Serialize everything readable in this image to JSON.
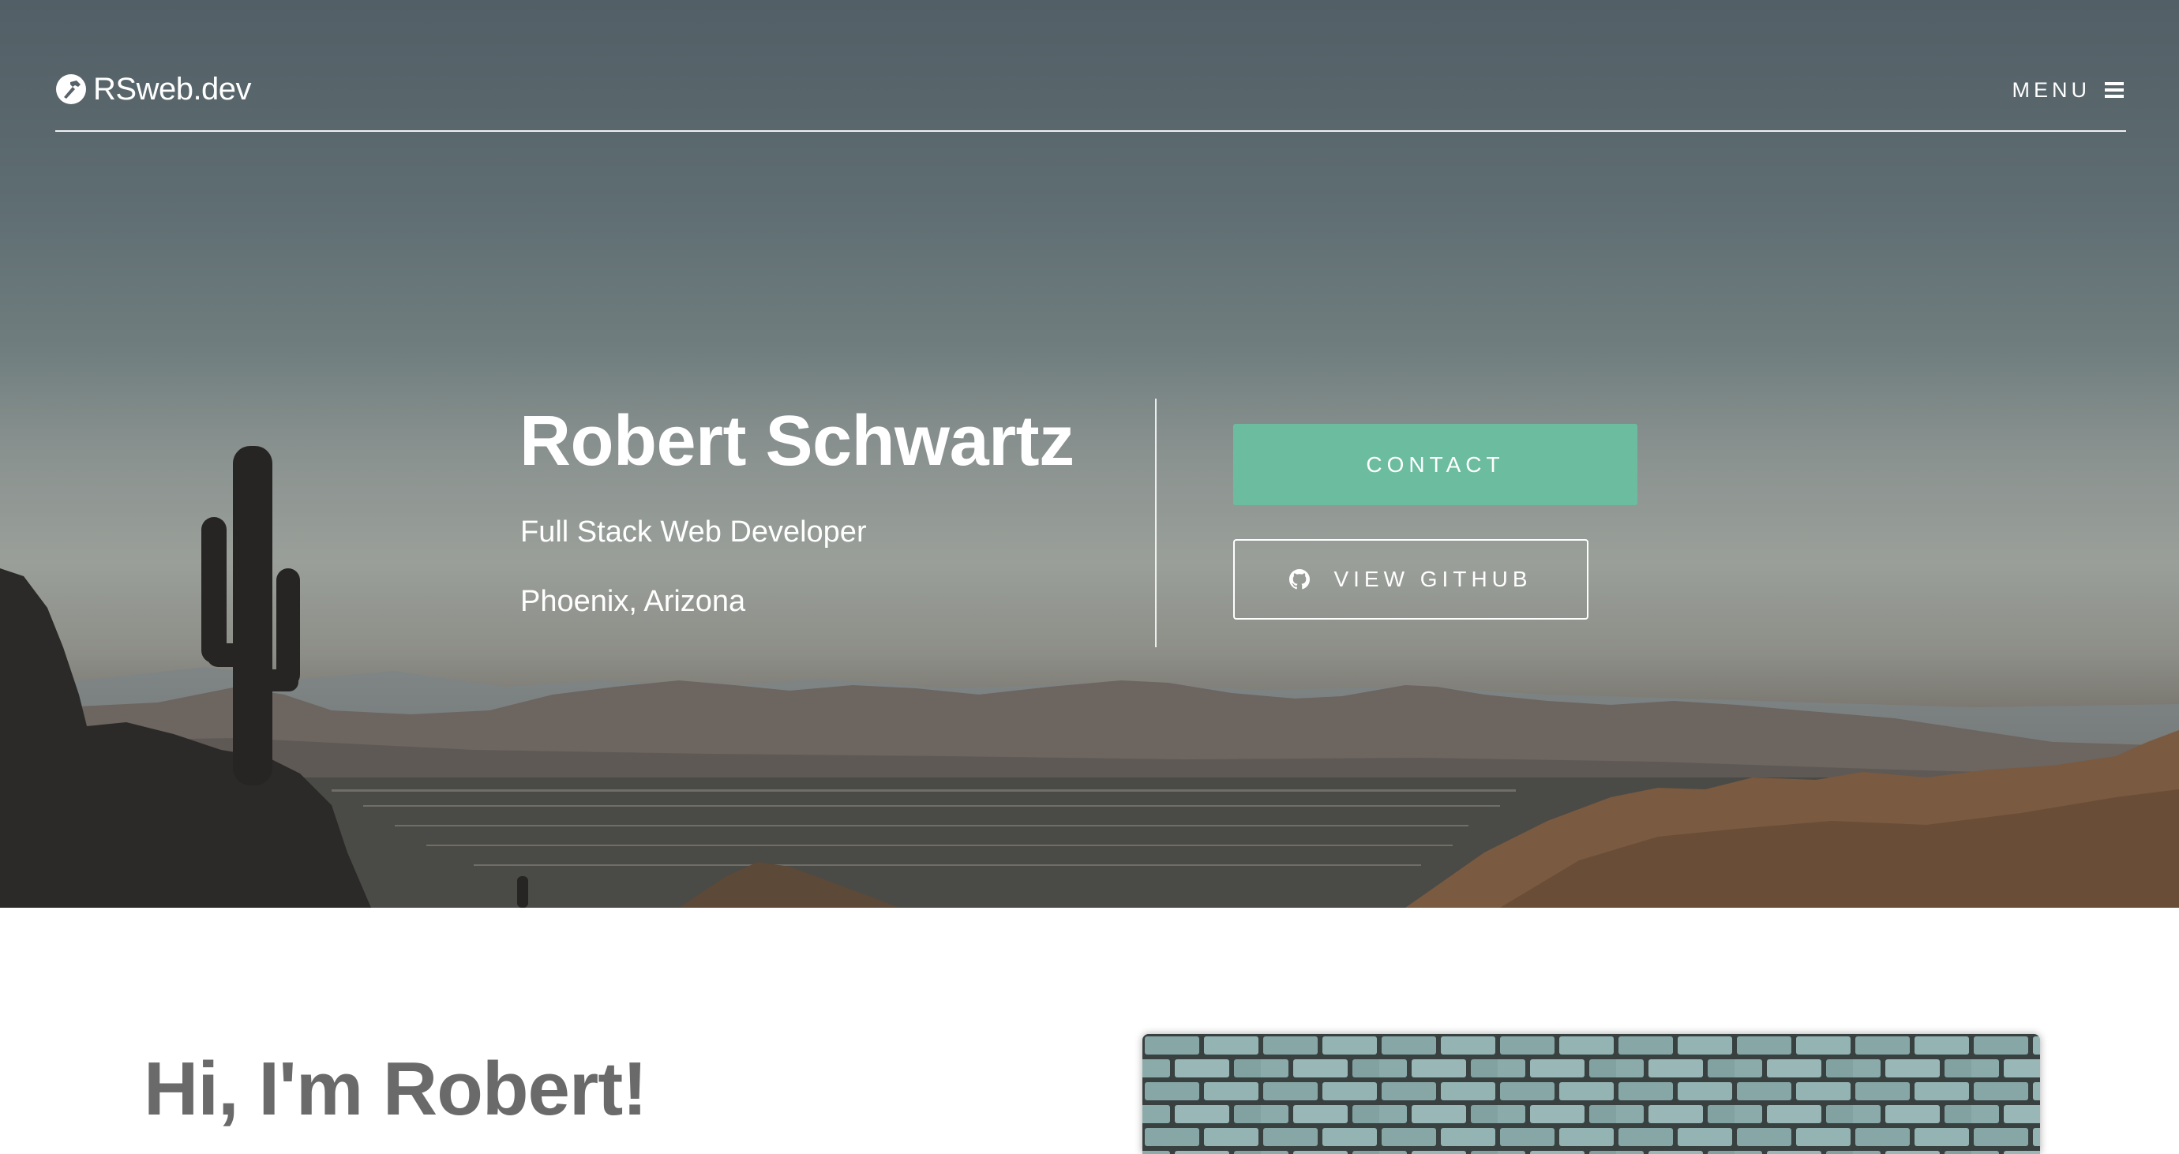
{
  "header": {
    "brand": "RSweb.dev",
    "brand_icon": "hammer-logo-icon",
    "menu_label": "MENU",
    "menu_icon": "hamburger-icon"
  },
  "hero": {
    "name": "Robert Schwartz",
    "role": "Full Stack Web Developer",
    "location": "Phoenix, Arizona",
    "contact_label": "CONTACT",
    "github_label": "VIEW GITHUB",
    "github_icon": "github-icon",
    "colors": {
      "accent": "#6cbda0",
      "text": "#ffffff"
    }
  },
  "about": {
    "heading": "Hi, I'm Robert!",
    "image": "brick-wall-photo",
    "heading_color": "#6a6a6a"
  }
}
